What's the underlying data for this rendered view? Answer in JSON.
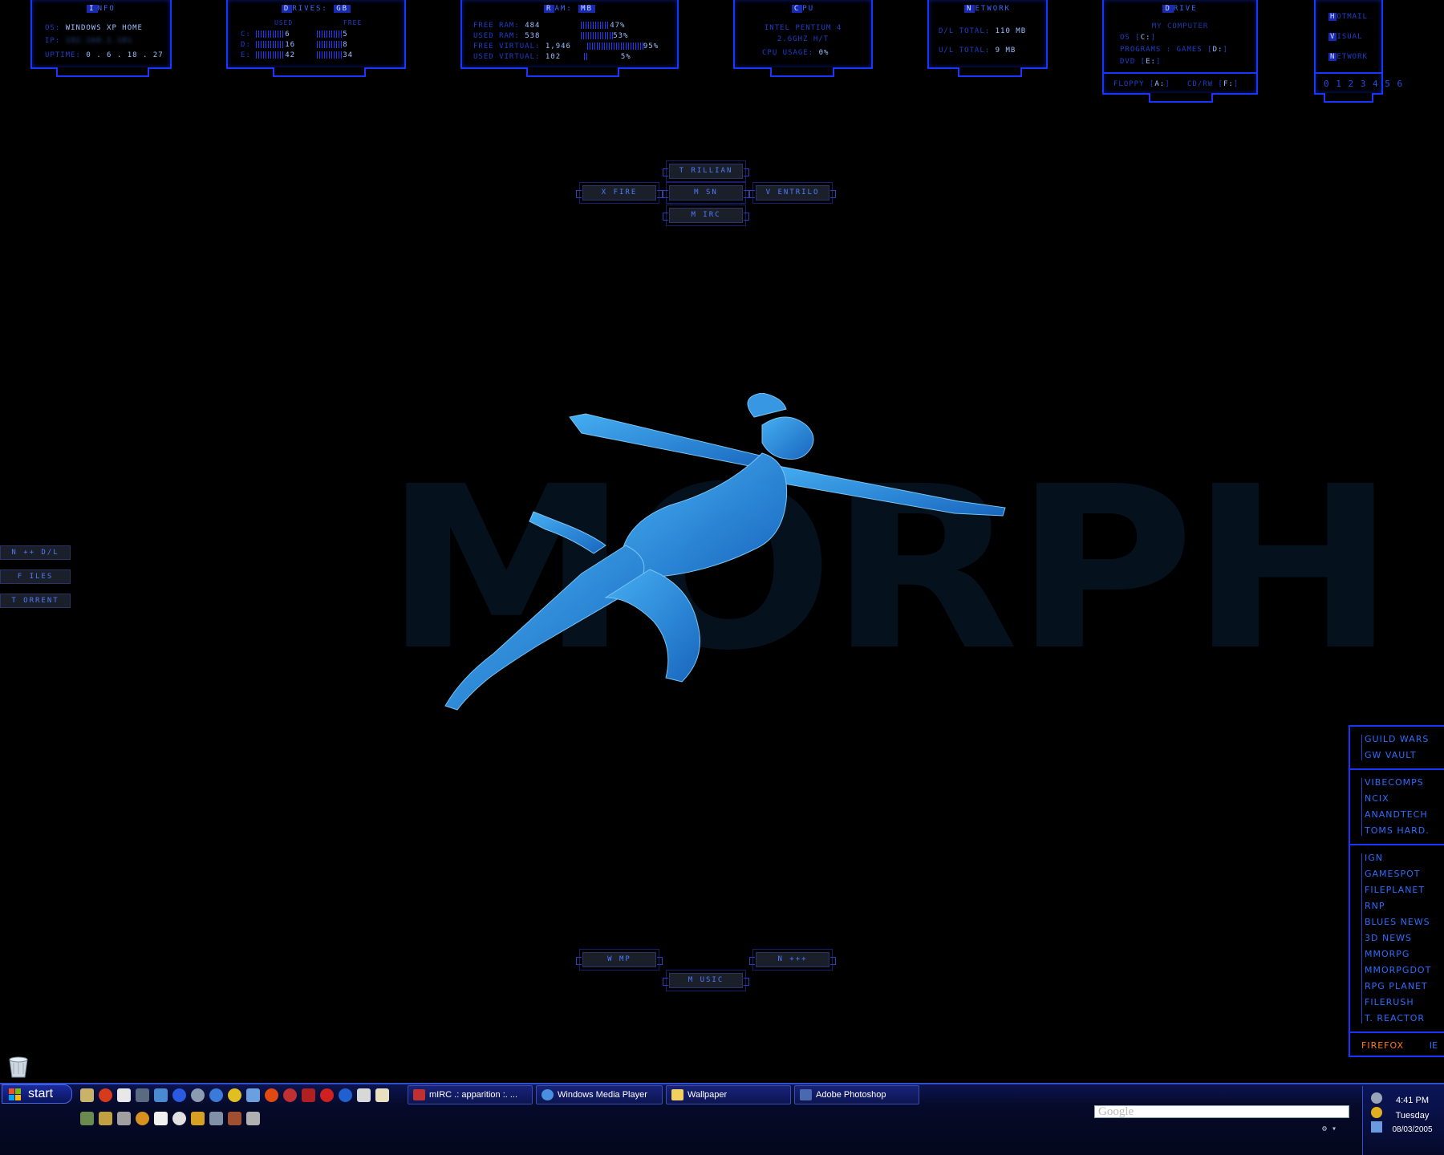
{
  "panels": {
    "info": {
      "title_hl": "I",
      "title": "NFO",
      "os_label": "OS:",
      "os": "WINDOWS XP HOME",
      "ip_label": "IP:",
      "ip": "192.168.1.101",
      "uptime_label": "UPTIME:",
      "uptime": "0 . 6 . 18 . 27"
    },
    "drives": {
      "title_hl": "D",
      "title": "RIVES:",
      "title_hl2": "GB",
      "used_label": "USED",
      "free_label": "FREE",
      "rows": [
        {
          "letter": "C:",
          "used": "6",
          "free": "5"
        },
        {
          "letter": "D:",
          "used": "16",
          "free": "8"
        },
        {
          "letter": "E:",
          "used": "42",
          "free": "34"
        }
      ]
    },
    "ram": {
      "title_hl": "R",
      "title": "AM:",
      "title_hl2": "MB",
      "rows": [
        {
          "label": "FREE RAM:",
          "val": "484",
          "pct": "47%"
        },
        {
          "label": "USED RAM:",
          "val": "538",
          "pct": "53%"
        },
        {
          "label": "FREE VIRTUAL:",
          "val": "1,946",
          "pct": "95%"
        },
        {
          "label": "USED VIRTUAL:",
          "val": "102",
          "pct": "5%"
        }
      ]
    },
    "cpu": {
      "title_hl": "C",
      "title": "PU",
      "line1": "INTEL PENTIUM 4",
      "line2": "2.6GHZ H/T",
      "usage_label": "CPU USAGE:",
      "usage": "0%"
    },
    "network": {
      "title_hl": "N",
      "title": "ETWORK",
      "dl_label": "D/L TOTAL:",
      "dl": "110 MB",
      "ul_label": "U/L TOTAL:",
      "ul": "9 MB"
    },
    "drive": {
      "title_hl": "D",
      "title": "RIVE",
      "mycomp": "MY COMPUTER",
      "os_label": "OS",
      "os": "C:",
      "programs_label": "PROGRAMS",
      "games_label": "GAMES",
      "games": "D:",
      "dvd_label": "DVD",
      "dvd": "E:",
      "floppy_label": "FLOPPY",
      "floppy": "A:",
      "cdrw_label": "CD/RW",
      "cdrw": "F:"
    },
    "mail": {
      "items": [
        {
          "hl": "H",
          "label": "OTMAIL"
        },
        {
          "hl": "V",
          "label": "ISUAL"
        },
        {
          "hl": "N",
          "label": "ETWORK"
        }
      ],
      "desktops": "0 1 2 3 4 5 6"
    }
  },
  "launch": {
    "trillian": "T RILLIAN",
    "xfire": "X FIRE",
    "msn": "M SN",
    "ventrilo": "V ENTRILO",
    "mirc": "M IRC",
    "wmp": "W MP",
    "npp": "N +++",
    "music": "M USIC"
  },
  "side": {
    "ndl": "N ++ D/L",
    "files": "F ILES",
    "torrent": "T ORRENT"
  },
  "bg_text": "MORPH",
  "links": {
    "group1": [
      "GUILD WARS",
      "GW VAULT"
    ],
    "group2": [
      "VIBECOMPS",
      "NCIX",
      "ANANDTECH",
      "TOMS HARD."
    ],
    "group3": [
      "IGN",
      "GAMESPOT",
      "FILEPLANET",
      "RNP",
      "BLUES NEWS",
      "3D NEWS",
      "MMORPG",
      "MMORPGDOT",
      "RPG PLANET",
      "FILERUSH",
      "T. REACTOR"
    ],
    "firefox": "FIREFOX",
    "ie": "IE"
  },
  "taskbar": {
    "start": "start",
    "tasks": [
      "mIRC .: apparition :. ...",
      "Windows Media Player",
      "Wallpaper",
      "Adobe Photoshop"
    ],
    "search_placeholder": "Google",
    "time": "4:41 PM",
    "day": "Tuesday",
    "date": "08/03/2005"
  },
  "colors": {
    "accent": "#1a35ff",
    "text": "#2e6cff",
    "firefox": "#ff7a1a"
  }
}
